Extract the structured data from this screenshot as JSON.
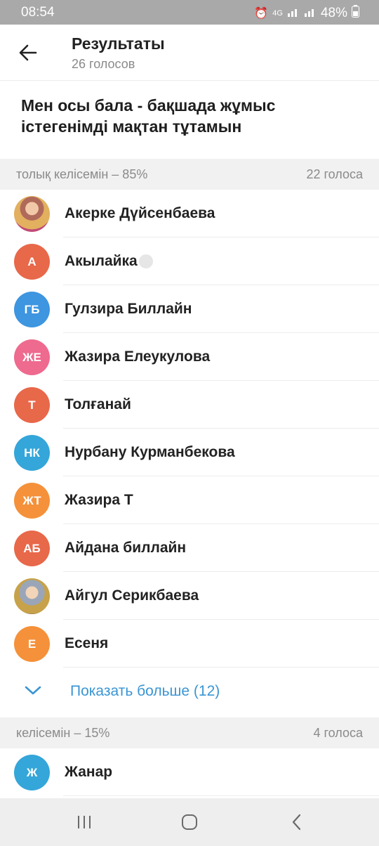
{
  "status_bar": {
    "time": "08:54",
    "network": "4G",
    "battery": "48%"
  },
  "header": {
    "title": "Результаты",
    "subtitle": "26 голосов"
  },
  "question": {
    "line1": "Мен осы бала - бақшада  жұмыс",
    "line2": "істегенімді мақтан тұтамын"
  },
  "sections": [
    {
      "label": "толық келісемін – 85%",
      "count": "22 голоса",
      "voters": [
        {
          "name": "Акерке Дүйсенбаева",
          "initials": "",
          "avatar": "photo"
        },
        {
          "name": "Акылайка",
          "initials": "А",
          "color": "#e8684a"
        },
        {
          "name": "Гулзира Биллайн",
          "initials": "ГБ",
          "color": "#3e95e0"
        },
        {
          "name": "Жазира Елеукулова",
          "initials": "ЖЕ",
          "color": "#ee6a8e"
        },
        {
          "name": "Толғанай",
          "initials": "Т",
          "color": "#e8684a"
        },
        {
          "name": "Нурбану Курманбекова",
          "initials": "НК",
          "color": "#34a6d9"
        },
        {
          "name": "Жазира Т",
          "initials": "ЖТ",
          "color": "#f5913a"
        },
        {
          "name": "Айдана биллайн",
          "initials": "АБ",
          "color": "#e8684a"
        },
        {
          "name": "Айгул Серикбаева",
          "initials": "",
          "avatar": "photo"
        },
        {
          "name": "Есеня",
          "initials": "Е",
          "color": "#f5913a"
        }
      ],
      "show_more": "Показать больше (12)"
    },
    {
      "label": "келісемін – 15%",
      "count": "4 голоса",
      "voters": [
        {
          "name": "Жанар",
          "initials": "Ж",
          "color": "#34a6d9"
        }
      ]
    }
  ],
  "icons": {
    "back": "arrow-left-icon",
    "show_more": "chevron-down-icon",
    "nav_recents": "recents-icon",
    "nav_home": "home-icon",
    "nav_back": "nav-back-icon"
  },
  "colors": {
    "accent": "#3a95d3",
    "section_bg": "#f1f1f1"
  }
}
